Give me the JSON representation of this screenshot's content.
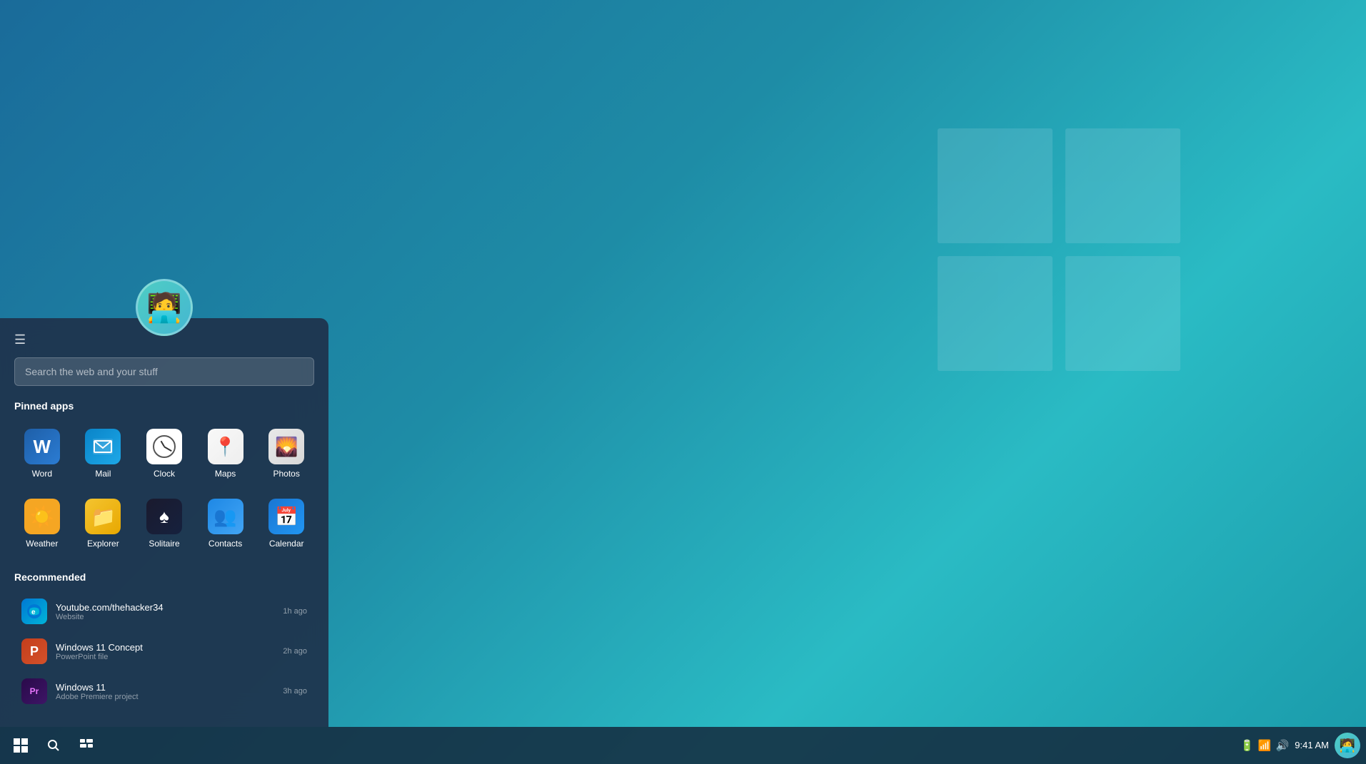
{
  "desktop": {
    "background": "teal-blue gradient"
  },
  "startMenu": {
    "searchPlaceholder": "Search the web and your stuff",
    "pinnedAppsTitle": "Pinned apps",
    "recommendedTitle": "Recommended",
    "pinnedApps": [
      {
        "id": "word",
        "label": "Word",
        "iconClass": "icon-word",
        "icon": "W"
      },
      {
        "id": "mail",
        "label": "Mail",
        "iconClass": "icon-mail",
        "icon": "✉"
      },
      {
        "id": "clock",
        "label": "Clock",
        "iconClass": "icon-clock",
        "icon": "clock"
      },
      {
        "id": "maps",
        "label": "Maps",
        "iconClass": "icon-maps",
        "icon": "📍"
      },
      {
        "id": "photos",
        "label": "Photos",
        "iconClass": "icon-photos",
        "icon": "🖼"
      },
      {
        "id": "weather",
        "label": "Weather",
        "iconClass": "icon-weather",
        "icon": "☀"
      },
      {
        "id": "explorer",
        "label": "Explorer",
        "iconClass": "icon-explorer",
        "icon": "📁"
      },
      {
        "id": "solitaire",
        "label": "Solitaire",
        "iconClass": "icon-solitaire",
        "icon": "♠"
      },
      {
        "id": "contacts",
        "label": "Contacts",
        "iconClass": "icon-contacts",
        "icon": "👥"
      },
      {
        "id": "calendar",
        "label": "Calendar",
        "iconClass": "icon-calendar",
        "icon": "📅"
      }
    ],
    "recommended": [
      {
        "id": "youtube",
        "title": "Youtube.com/thehacker34",
        "subtitle": "Website",
        "time": "1h ago",
        "iconClass": "rec-icon-edge",
        "icon": "e"
      },
      {
        "id": "win11concept",
        "title": "Windows 11 Concept",
        "subtitle": "PowerPoint file",
        "time": "2h ago",
        "iconClass": "rec-icon-ppt",
        "icon": "P"
      },
      {
        "id": "win11",
        "title": "Windows 11",
        "subtitle": "Adobe Premiere project",
        "time": "3h ago",
        "iconClass": "rec-icon-premiere",
        "icon": "Pr"
      }
    ]
  },
  "taskbar": {
    "time": "9:41 AM",
    "startIcon": "⊞",
    "searchIcon": "🔍",
    "taskviewIcon": "⊡"
  }
}
